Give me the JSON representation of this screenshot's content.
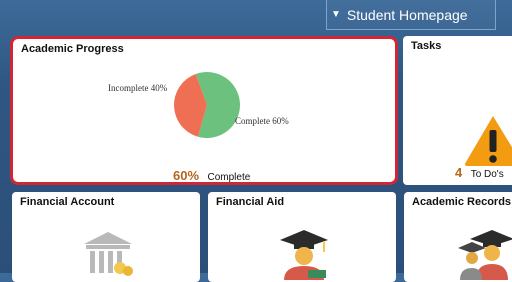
{
  "header": {
    "nav_label": "Student Homepage"
  },
  "tiles": {
    "academic_progress": {
      "title": "Academic Progress",
      "incomplete_label": "Incomplete 40%",
      "complete_label": "Complete 60%",
      "percent": "60%",
      "percent_label": "Complete",
      "colors": {
        "complete": "#6cc17f",
        "incomplete": "#ef6f55"
      }
    },
    "tasks": {
      "title": "Tasks",
      "count": "4",
      "count_label": "To Do's"
    },
    "financial_account": {
      "title": "Financial Account"
    },
    "financial_aid": {
      "title": "Financial Aid"
    },
    "academic_records": {
      "title": "Academic Records"
    }
  },
  "chart_data": {
    "type": "pie",
    "categories": [
      "Complete",
      "Incomplete"
    ],
    "values": [
      60,
      40
    ]
  }
}
